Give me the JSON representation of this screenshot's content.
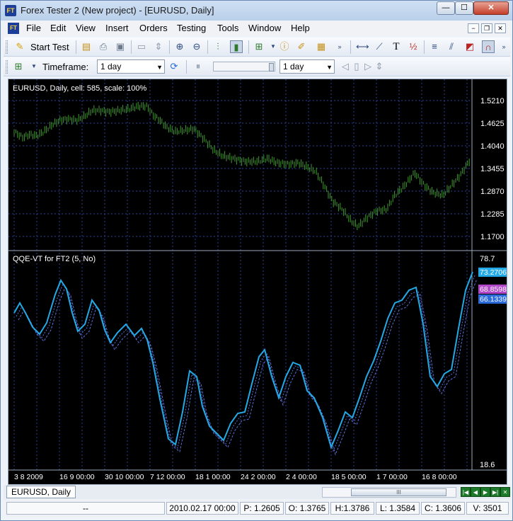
{
  "window": {
    "title": "Forex Tester 2  (New project) - [EURUSD, Daily]",
    "app_icon": "FT",
    "controls": {
      "minimize": "—",
      "maximize": "☐",
      "close": "✕"
    }
  },
  "menu": {
    "items": [
      "File",
      "Edit",
      "View",
      "Insert",
      "Orders",
      "Testing",
      "Tools",
      "Window",
      "Help"
    ],
    "mdi_controls": [
      "−",
      "❐",
      "✕"
    ]
  },
  "toolbar1": {
    "start_test": "Start Test",
    "text_tool": "T"
  },
  "toolbar2": {
    "timeframe_label": "Timeframe:",
    "timeframe_value": "1 day",
    "speed_value": "1 day"
  },
  "chart": {
    "price_header": "EURUSD, Daily, cell: 585, scale: 100%",
    "indicator_header": "QQE-VT for FT2 (5, No)",
    "price_ticks": [
      "1.5210",
      "1.4625",
      "1.4040",
      "1.3455",
      "1.2870",
      "1.2285",
      "1.1700"
    ],
    "indicator_top": "78.7",
    "indicator_bottom": "18.6",
    "indicator_labels": [
      {
        "text": "73.2706",
        "color": "#23a9e6"
      },
      {
        "text": "68.8598",
        "color": "#b247c9"
      },
      {
        "text": "66.1339",
        "color": "#2a6bdc"
      }
    ],
    "date_labels": [
      "3 8 2009",
      "16 9 00:00",
      "30 10 00:00",
      "7 12 00:00",
      "18 1 00:00",
      "24 2 00:00",
      "2 4 00:00",
      "18 5 00:00",
      "1 7 00:00",
      "16 8 00:00"
    ],
    "colors": {
      "price": "#3f9a2c",
      "qqe_main": "#23a9e6",
      "qqe_signal": "#5b6fd8",
      "grid": "#2b3f9e"
    }
  },
  "bottom": {
    "tab": "EURUSD, Daily",
    "scroll_grip": "III",
    "nav": [
      "|◀",
      "◀",
      "▶",
      "▶|",
      "✕"
    ]
  },
  "status": {
    "cells": [
      "--",
      "2010.02.17 00:00",
      "P: 1.2605",
      "O: 1.3765",
      "H:1.3786",
      "L: 1.3584",
      "C: 1.3606",
      "V: 3501"
    ]
  }
}
